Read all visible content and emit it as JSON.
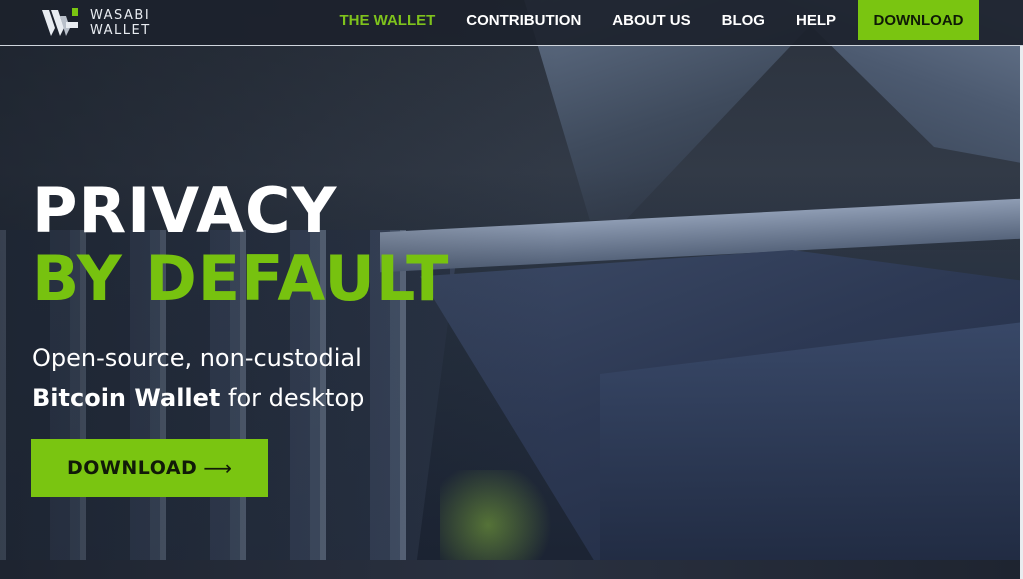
{
  "brand": {
    "line1": "WASABI",
    "line2": "WALLET"
  },
  "nav": {
    "items": [
      {
        "label": "THE WALLET",
        "active": true
      },
      {
        "label": "CONTRIBUTION",
        "active": false
      },
      {
        "label": "ABOUT US",
        "active": false
      },
      {
        "label": "BLOG",
        "active": false
      },
      {
        "label": "HELP",
        "active": false
      }
    ],
    "download_label": "DOWNLOAD"
  },
  "hero": {
    "title_line1": "PRIVACY",
    "title_line2": "BY DEFAULT",
    "subtitle_line1": "Open-source, non-custodial",
    "subtitle_bold": "Bitcoin Wallet",
    "subtitle_rest": " for desktop",
    "cta_label": "DOWNLOAD",
    "cta_arrow": "⟶"
  },
  "icons": {
    "logo": "wasabi-logo-icon",
    "arrow": "arrow-right-icon"
  },
  "colors": {
    "accent": "#7ac511",
    "nav_bg": "#1c222c",
    "text": "#ffffff"
  }
}
